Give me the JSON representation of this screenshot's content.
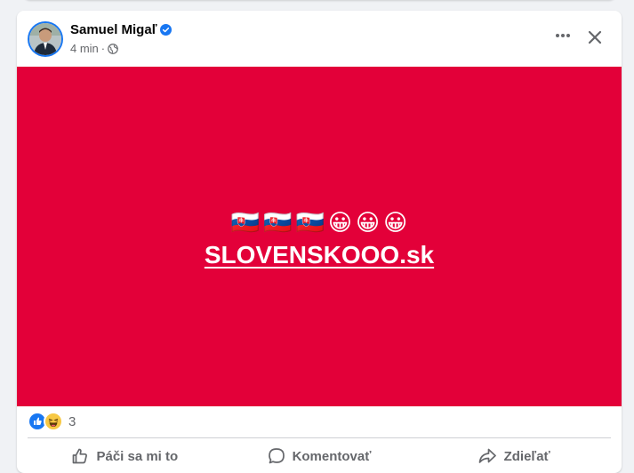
{
  "post": {
    "author_name": "Samuel Migaľ",
    "time": "4 min",
    "separator": "·",
    "media": {
      "background_color": "#e30039",
      "flags": [
        "🇸🇰",
        "🇸🇰",
        "🇸🇰"
      ],
      "emojis": [
        "😀",
        "😀",
        "😀"
      ],
      "link_text": "SLOVENSKOOO.sk"
    },
    "reactions": {
      "icons": [
        "like-icon",
        "haha-icon"
      ],
      "count": "3"
    },
    "actions": {
      "like_label": "Páči sa mi to",
      "comment_label": "Komentovať",
      "share_label": "Zdieľať"
    }
  },
  "colors": {
    "accent": "#1877f2",
    "text_secondary": "#65676b",
    "text_primary": "#050505"
  }
}
